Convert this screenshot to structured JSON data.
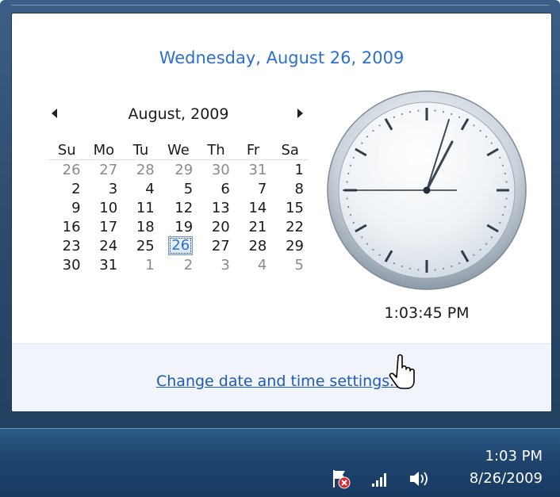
{
  "header": {
    "date_long": "Wednesday, August 26, 2009"
  },
  "calendar": {
    "month_title": "August, 2009",
    "weekdays": [
      "Su",
      "Mo",
      "Tu",
      "We",
      "Th",
      "Fr",
      "Sa"
    ],
    "weeks": [
      [
        "26",
        "27",
        "28",
        "29",
        "30",
        "31",
        "1"
      ],
      [
        "2",
        "3",
        "4",
        "5",
        "6",
        "7",
        "8"
      ],
      [
        "9",
        "10",
        "11",
        "12",
        "13",
        "14",
        "15"
      ],
      [
        "16",
        "17",
        "18",
        "19",
        "20",
        "21",
        "22"
      ],
      [
        "23",
        "24",
        "25",
        "26",
        "27",
        "28",
        "29"
      ],
      [
        "30",
        "31",
        "1",
        "2",
        "3",
        "4",
        "5"
      ]
    ],
    "selected_day": "26"
  },
  "clock": {
    "time_text": "1:03:45 PM"
  },
  "footer": {
    "link_label": "Change date and time settings..."
  },
  "taskbar": {
    "time": "1:03 PM",
    "date": "8/26/2009",
    "icons": [
      "action-center-flag-icon",
      "network-signal-icon",
      "volume-icon"
    ]
  },
  "colors": {
    "accent_blue": "#2c6fd1",
    "link_blue": "#1e5ab8",
    "taskbar": "#1f4670"
  }
}
